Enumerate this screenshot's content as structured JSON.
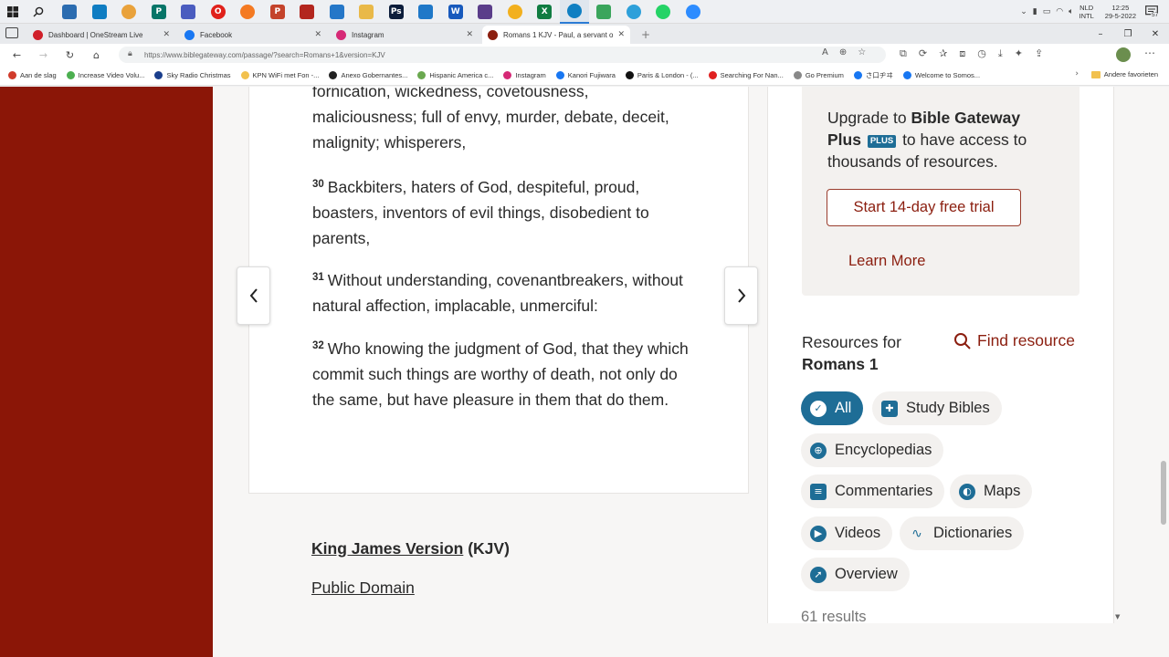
{
  "taskbar": {
    "apps": [
      {
        "icon": "task-view-icon",
        "label": ""
      },
      {
        "icon": "store-icon",
        "label": ""
      },
      {
        "icon": "chrome-icon",
        "label": ""
      },
      {
        "icon": "publisher-icon",
        "label": "P"
      },
      {
        "icon": "snip-icon",
        "label": ""
      },
      {
        "icon": "opera-icon",
        "label": "O"
      },
      {
        "icon": "firefox-icon",
        "label": ""
      },
      {
        "icon": "powerpoint-icon",
        "label": "P"
      },
      {
        "icon": "red-app-icon",
        "label": ""
      },
      {
        "icon": "mail-icon",
        "label": ""
      },
      {
        "icon": "folder-icon",
        "label": ""
      },
      {
        "icon": "photoshop-icon",
        "label": "Ps"
      },
      {
        "icon": "photos-icon",
        "label": ""
      },
      {
        "icon": "word-icon",
        "label": "W"
      },
      {
        "icon": "video-editor-icon",
        "label": ""
      },
      {
        "icon": "canary-icon",
        "label": ""
      },
      {
        "icon": "excel-icon",
        "label": "X"
      },
      {
        "icon": "edge-icon",
        "label": ""
      },
      {
        "icon": "chat-icon",
        "label": ""
      },
      {
        "icon": "telegram-icon",
        "label": ""
      },
      {
        "icon": "whatsapp-icon",
        "label": ""
      },
      {
        "icon": "messenger-icon",
        "label": ""
      }
    ],
    "tray": {
      "lang_top": "NLD",
      "lang_bottom": "INTL",
      "time": "12:25",
      "date": "29-5-2022",
      "notifications": "57"
    }
  },
  "tabs": [
    {
      "title": "Dashboard | OneStream Live",
      "color": "#d0202a",
      "icon": "play-icon"
    },
    {
      "title": "Facebook",
      "color": "#1877f2",
      "icon": "facebook-icon"
    },
    {
      "title": "Instagram",
      "color": "#d62976",
      "icon": "instagram-icon"
    },
    {
      "title": "Romans 1 KJV - Paul, a servant o",
      "color": "#8b1e0f",
      "icon": "biblegateway-icon",
      "active": true
    }
  ],
  "address": {
    "url": "https://www.biblegateway.com/passage/?search=Romans+1&version=KJV"
  },
  "bookmarks": [
    {
      "label": "Aan de slag",
      "color": "#d03b2b"
    },
    {
      "label": "Increase Video Volu...",
      "color": "#4caf50"
    },
    {
      "label": "Sky Radio Christmas",
      "color": "#1a3e8c"
    },
    {
      "label": "KPN WiFi met Fon -...",
      "color": "#f2c14e"
    },
    {
      "label": "Anexo Gobernantes...",
      "color": "#222222"
    },
    {
      "label": "Hispanic America c...",
      "color": "#6aa84f"
    },
    {
      "label": "Instagram",
      "color": "#d62976"
    },
    {
      "label": "Kanori Fujiwara",
      "color": "#1877f2"
    },
    {
      "label": "Paris & London - (...",
      "color": "#111111"
    },
    {
      "label": "Searching For Nan...",
      "color": "#e02020"
    },
    {
      "label": "Go Premium",
      "color": "#888888"
    },
    {
      "label": "さ口ヂヰ",
      "color": "#1877f2"
    },
    {
      "label": "Welcome to Somos...",
      "color": "#1877f2"
    }
  ],
  "bookmarks_end": "Andere favorieten",
  "passage": {
    "verses": [
      {
        "num": "",
        "text": "fornication, wickedness, covetousness, maliciousness; full of envy, murder, debate, deceit, malignity; whisperers,"
      },
      {
        "num": "30",
        "text": "Backbiters, haters of God, despiteful, proud, boasters, inventors of evil things, disobedient to parents,"
      },
      {
        "num": "31",
        "text": "Without understanding, covenantbreakers, without natural affection, implacable, unmerciful:"
      },
      {
        "num": "32",
        "text": "Who knowing the judgment of God, that they which commit such things are worthy of death, not only do the same, but have pleasure in them that do them."
      }
    ],
    "version_name": "King James Version",
    "version_abbr": "(KJV)",
    "copyright": "Public Domain"
  },
  "upgrade": {
    "prefix": "Upgrade to",
    "brand": "Bible Gateway Plus",
    "brand_a": "Bible Gateway",
    "brand_b": "Plus",
    "badge": "PLUS",
    "suffix": "to have access to thousands of resources.",
    "trial_button": "Start 14-day free trial",
    "learn_more": "Learn More"
  },
  "resources": {
    "title_line1": "Resources for",
    "title_line2": "Romans 1",
    "find": "Find resource",
    "chips": [
      {
        "label": "All",
        "icon": "check-icon",
        "selected": true
      },
      {
        "label": "Study Bibles",
        "icon": "study-bible-icon"
      },
      {
        "label": "Encyclopedias",
        "icon": "globe-icon"
      },
      {
        "label": "Commentaries",
        "icon": "comment-icon"
      },
      {
        "label": "Maps",
        "icon": "map-icon"
      },
      {
        "label": "Videos",
        "icon": "play-icon"
      },
      {
        "label": "Dictionaries",
        "icon": "dictionary-icon"
      },
      {
        "label": "Overview",
        "icon": "compass-icon"
      }
    ],
    "results": "61 results"
  },
  "colors": {
    "sidebar_red": "#8b1607",
    "accent_blue": "#1e6d96",
    "link_red": "#8b1e0f"
  }
}
